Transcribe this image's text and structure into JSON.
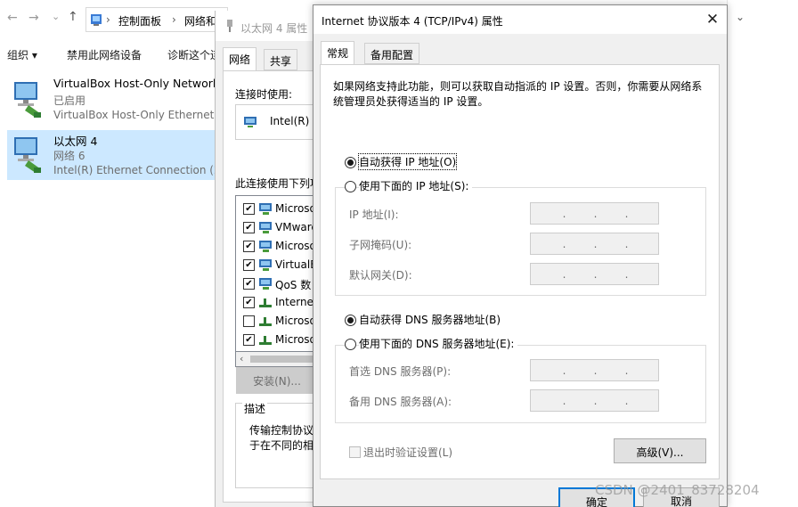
{
  "explorer": {
    "address_parts": [
      "控制面板",
      "网络和"
    ],
    "commands": [
      "组织 ▾",
      "禁用此网络设备",
      "诊断这个连"
    ],
    "items": [
      {
        "title": "VirtualBox Host-Only Network",
        "status": "已启用",
        "adapter": "VirtualBox Host-Only Ethernet ..."
      },
      {
        "title": "以太网 4",
        "status": "网络 6",
        "adapter": "Intel(R) Ethernet Connection (2..."
      }
    ]
  },
  "eth_dialog": {
    "title": "以太网 4 属性",
    "tabs": [
      "网络",
      "共享"
    ],
    "connect_using_label": "连接时使用:",
    "adapter": "Intel(R) E",
    "components_label": "此连接使用下列项",
    "components": [
      {
        "name": "Microso",
        "checked": true
      },
      {
        "name": "VMware",
        "checked": true
      },
      {
        "name": "Microso",
        "checked": true
      },
      {
        "name": "VirtualB",
        "checked": true
      },
      {
        "name": "QoS 数",
        "checked": true
      },
      {
        "name": "Internet",
        "checked": true
      },
      {
        "name": "Microso",
        "checked": false
      },
      {
        "name": "Microso",
        "checked": true
      }
    ],
    "install_button": "安装(N)...",
    "description_label": "描述",
    "description_lines": [
      "传输控制协议",
      "于在不同的相"
    ]
  },
  "ipv4_dialog": {
    "title": "Internet 协议版本 4 (TCP/IPv4) 属性",
    "tabs": [
      "常规",
      "备用配置"
    ],
    "info_text": "如果网络支持此功能，则可以获取自动指派的 IP 设置。否则，你需要从网络系统管理员处获得适当的 IP 设置。",
    "auto_ip_label": "自动获得 IP 地址(O)",
    "manual_ip_label": "使用下面的 IP 地址(S):",
    "ip_label": "IP 地址(I):",
    "subnet_label": "子网掩码(U):",
    "gateway_label": "默认网关(D):",
    "auto_dns_label": "自动获得 DNS 服务器地址(B)",
    "manual_dns_label": "使用下面的 DNS 服务器地址(E):",
    "preferred_dns_label": "首选 DNS 服务器(P):",
    "alternate_dns_label": "备用 DNS 服务器(A):",
    "validate_label": "退出时验证设置(L)",
    "advanced_button": "高级(V)...",
    "ok_button": "确定",
    "cancel_button": "取消",
    "selected_ip_mode": "auto",
    "selected_dns_mode": "auto",
    "validate_checked": false
  },
  "watermark": "CSDN @2401_83728204",
  "colors": {
    "selection": "#cce8ff",
    "accent": "#0078d7",
    "dialog_bg": "#f0f0f0"
  }
}
